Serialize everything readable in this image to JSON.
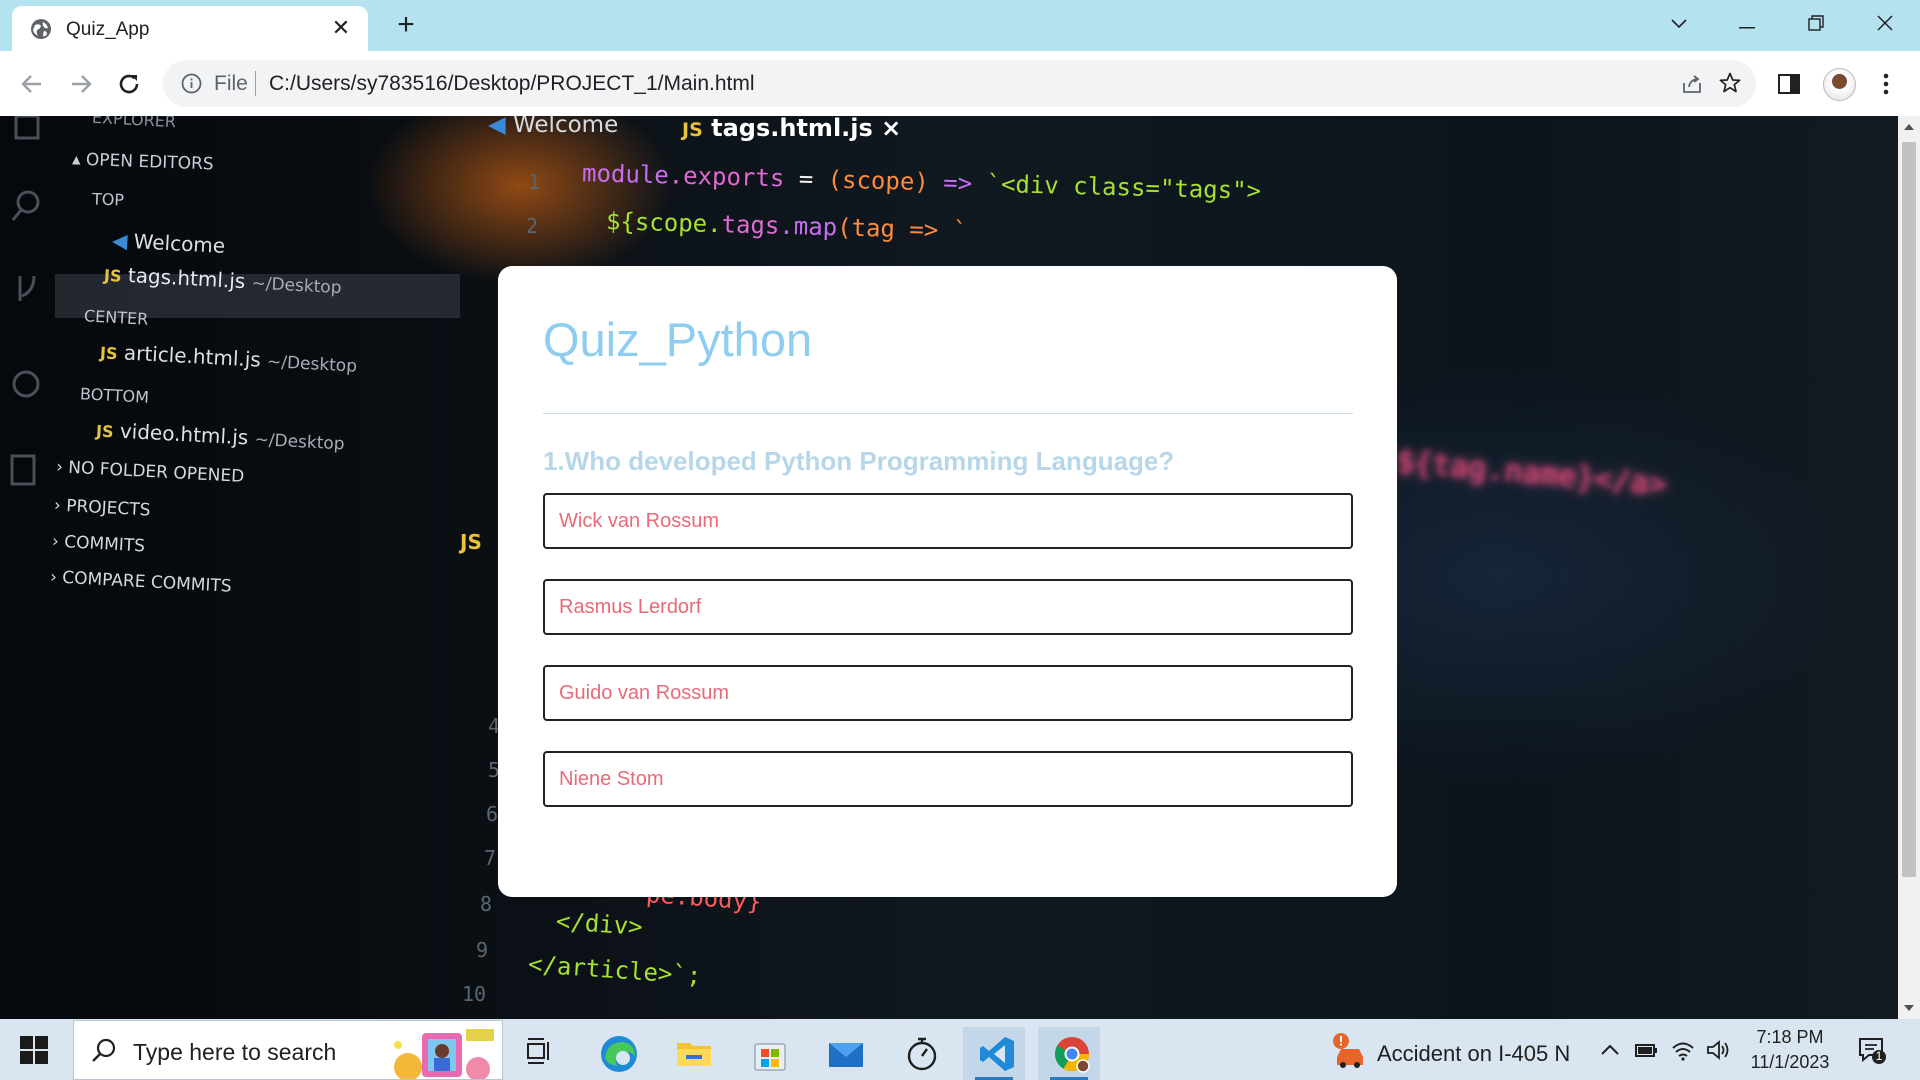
{
  "browser": {
    "tab_title": "Quiz_App",
    "address_scheme": "File",
    "address_url": "C:/Users/sy783516/Desktop/PROJECT_1/Main.html"
  },
  "background": {
    "sidebar": {
      "explorer": "EXPLORER",
      "open_editors": "OPEN EDITORS",
      "top": "TOP",
      "welcome": "Welcome",
      "tags_file": "tags.html.js",
      "tags_path": "~/Desktop",
      "center": "CENTER",
      "article_file": "article.html.js",
      "article_path": "~/Desktop",
      "bottom": "BOTTOM",
      "video_file": "video.html.js",
      "video_path": "~/Desktop",
      "no_folder": "NO FOLDER OPENED",
      "projects": "PROJECTS",
      "commits": "COMMITS",
      "compare_commits": "COMPARE COMMITS"
    },
    "editor": {
      "tab_welcome": "Welcome",
      "tab_js": "JS",
      "tab_file": "tags.html.js",
      "tab_close": "×",
      "js_badge": "JS",
      "line1_a": "module",
      "line1_b": ".exports",
      "line1_c": " = ",
      "line1_d": "(scope)",
      "line1_e": " => ",
      "line1_f": "`<div class=\"tags\">",
      "line2_a": "${scope.",
      "line2_b": "tags",
      "line2_c": ".map",
      "line2_d": "(tag => `",
      "line8": "pe.body}",
      "line9": "</div>",
      "line10": "</article>`;",
      "tag_name_blur": "${tag.name}</a>",
      "line_numbers": [
        "1",
        "2",
        "4",
        "5",
        "6",
        "7",
        "8",
        "9",
        "10"
      ]
    }
  },
  "quiz": {
    "title": "Quiz_Python",
    "question": "1.Who developed Python Programming Language?",
    "options": [
      "Wick van Rossum",
      "Rasmus Lerdorf",
      "Guido van Rossum",
      "Niene Stom"
    ]
  },
  "taskbar": {
    "search_placeholder": "Type here to search",
    "news_text": "Accident on I-405 N",
    "time": "7:18 PM",
    "date": "11/1/2023",
    "notification_count": "1"
  },
  "colors": {
    "quiz_title": "#8ecdf0",
    "question": "#b6d7ea",
    "option_text": "#e86a78",
    "tabstrip": "#b4e2ef"
  }
}
